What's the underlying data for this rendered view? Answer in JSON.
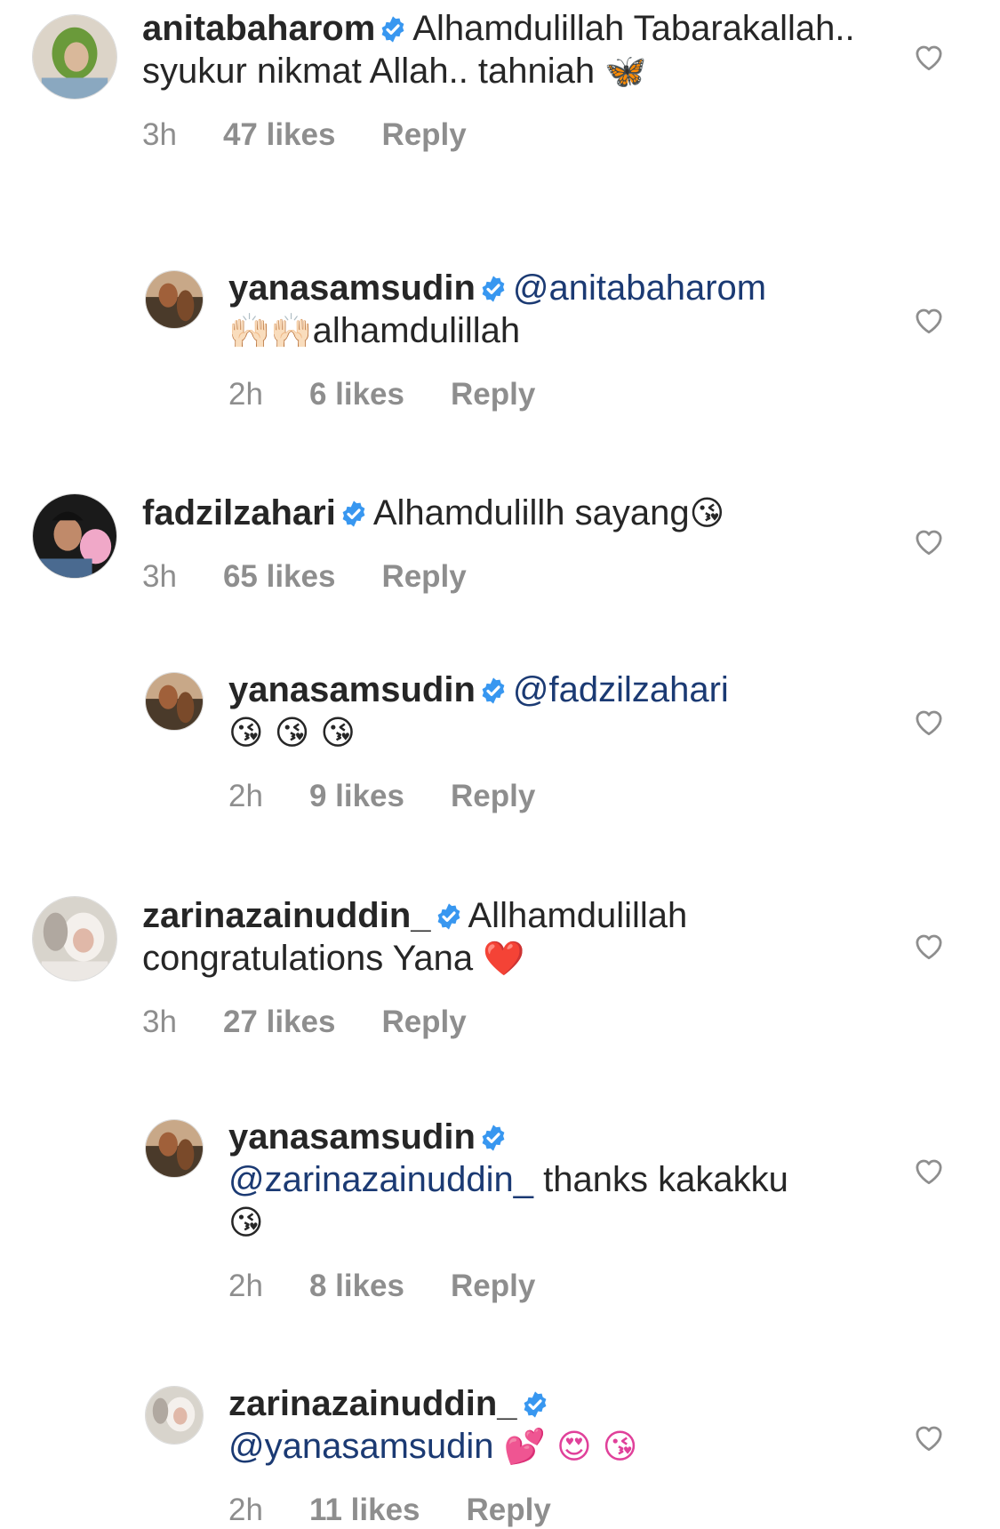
{
  "comments": [
    {
      "username": "anitabaharom",
      "text": "Alhamdulillah Tabarakallah.. syukur nikmat Allah.. tahniah",
      "emoji": "🦋",
      "time": "3h",
      "likes": "47 likes",
      "reply_label": "Reply",
      "avatar": "hijab-woman-avatar",
      "avatar_colors": [
        "#6a9a3a",
        "#d8c8b0",
        "#8aa8c0"
      ]
    },
    {
      "username": "yanasamsudin",
      "mention": "@anitabaharom",
      "emoji": "🙌🏻🙌🏻",
      "text": "alhamdulillah",
      "time": "2h",
      "likes": "6 likes",
      "reply_label": "Reply",
      "avatar": "horse-photo-avatar",
      "avatar_colors": [
        "#a0603a",
        "#4a3a2a",
        "#c8a888"
      ]
    },
    {
      "username": "fadzilzahari",
      "text": "Alhamdulillh sayang",
      "emoji": "😘",
      "time": "3h",
      "likes": "65 likes",
      "reply_label": "Reply",
      "avatar": "man-with-cap-avatar",
      "avatar_colors": [
        "#1a1a1a",
        "#f0a8c8",
        "#d09070"
      ]
    },
    {
      "username": "yanasamsudin",
      "mention": "@fadzilzahari",
      "emoji": "😘 😘 😘",
      "time": "2h",
      "likes": "9 likes",
      "reply_label": "Reply",
      "avatar": "horse-photo-avatar",
      "avatar_colors": [
        "#a0603a",
        "#4a3a2a",
        "#c8a888"
      ]
    },
    {
      "username": "zarinazainuddin_",
      "text": "Allhamdulillah congratulations Yana",
      "emoji": "❤️",
      "time": "3h",
      "likes": "27 likes",
      "reply_label": "Reply",
      "avatar": "woman-white-hijab-avatar",
      "avatar_colors": [
        "#e8e4e0",
        "#b0a8a0",
        "#d8c0b8"
      ]
    },
    {
      "username": "yanasamsudin",
      "mention": "@zarinazainuddin_",
      "text": "thanks kakakku",
      "emoji": "😘",
      "time": "2h",
      "likes": "8 likes",
      "reply_label": "Reply",
      "avatar": "horse-photo-avatar",
      "avatar_colors": [
        "#a0603a",
        "#4a3a2a",
        "#c8a888"
      ]
    },
    {
      "username": "zarinazainuddin_",
      "mention": "@yanasamsudin",
      "emoji": "💕 😍 😘",
      "time": "2h",
      "likes": "11 likes",
      "reply_label": "Reply",
      "avatar": "woman-white-hijab-avatar",
      "avatar_colors": [
        "#e8e4e0",
        "#b0a8a0",
        "#d8c0b8"
      ]
    }
  ],
  "colors": {
    "verified_badge": "#3897f0",
    "mention": "#1b3a73",
    "meta": "#8e8e8e",
    "heart_stroke": "#8e8e8e"
  },
  "icons": {
    "verified": "verified-badge-icon",
    "like": "heart-outline-icon"
  }
}
